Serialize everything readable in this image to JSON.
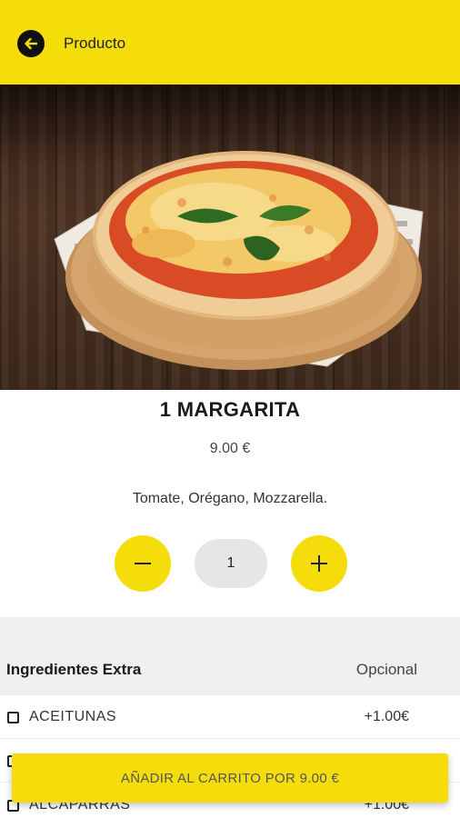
{
  "colors": {
    "accent": "#f5dd0c",
    "text_dark": "#1a1a1a",
    "band_gray": "#f0f0f0"
  },
  "header": {
    "back_icon": "arrow-left-icon",
    "title": "Producto"
  },
  "product": {
    "image_icon": "pizza-margarita-photo",
    "name": "1 MARGARITA",
    "price": "9.00 €",
    "description": "Tomate, Orégano, Mozzarella."
  },
  "quantity": {
    "minus_icon": "minus-icon",
    "plus_icon": "plus-icon",
    "value": "1"
  },
  "extras": {
    "title": "Ingredientes Extra",
    "optional_label": "Opcional",
    "items": [
      {
        "name": "ACEITUNAS",
        "price": "+1.00€"
      },
      {
        "name": "",
        "price": ""
      },
      {
        "name": "ALCAPARRAS",
        "price": "+1.00€"
      }
    ]
  },
  "cart": {
    "add_label": "AÑADIR AL CARRITO POR 9.00 €"
  }
}
